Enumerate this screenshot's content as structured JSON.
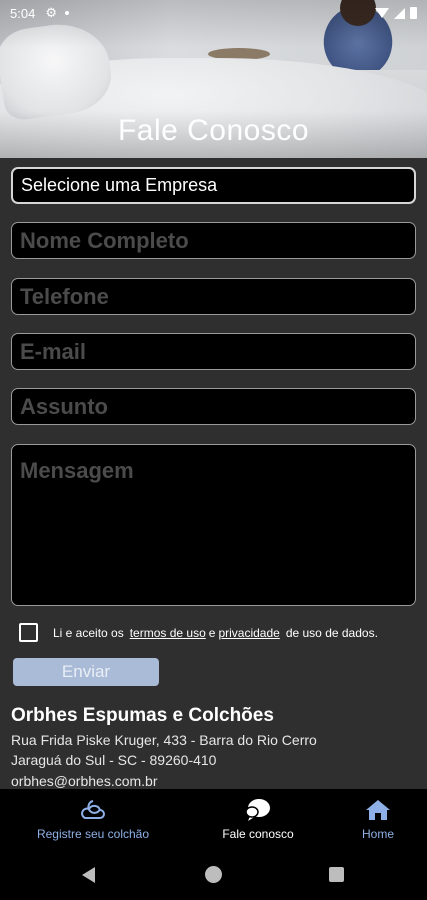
{
  "status_bar": {
    "time": "5:04"
  },
  "header": {
    "title": "Fale Conosco"
  },
  "form": {
    "company_select": "Selecione uma Empresa",
    "name_placeholder": "Nome Completo",
    "phone_placeholder": "Telefone",
    "email_placeholder": "E-mail",
    "subject_placeholder": "Assunto",
    "message_placeholder": "Mensagem",
    "terms": {
      "prefix": "Li e aceito os",
      "terms_link": "termos de uso",
      "conjunction": "e",
      "privacy_link": "privacidade",
      "suffix": "de uso de dados."
    },
    "submit_label": "Enviar"
  },
  "company": {
    "name": "Orbhes Espumas e Colchões",
    "address_line1": "Rua Frida Piske Kruger, 433 - Barra do Rio Cerro",
    "address_line2": "Jaraguá do Sul - SC - 89260-410",
    "email": "orbhes@orbhes.com.br"
  },
  "bottom_nav": {
    "items": [
      {
        "label": "Registre seu colchão",
        "icon": "weather-cloud-icon"
      },
      {
        "label": "Fale conosco",
        "icon": "chat-bubble-icon",
        "active": true
      },
      {
        "label": "Home",
        "icon": "home-icon"
      }
    ],
    "active_color": "#ffffff",
    "inactive_color": "#8fb0e6"
  },
  "colors": {
    "background": "#2f2f2f",
    "field_background": "#000000",
    "button_background": "#a9bbd6"
  }
}
